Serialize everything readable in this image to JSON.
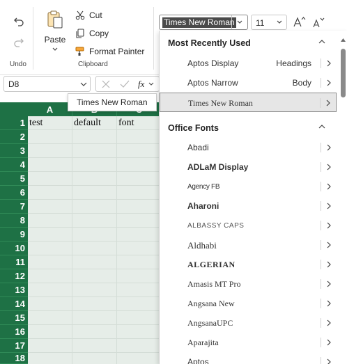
{
  "ribbon": {
    "undo_group_label": "Undo",
    "clipboard_group_label": "Clipboard",
    "paste_label": "Paste",
    "cut_label": "Cut",
    "copy_label": "Copy",
    "format_painter_label": "Format Painter",
    "font_name": "Times New Roman",
    "font_size": "11"
  },
  "formula_bar": {
    "name_box": "D8",
    "fx_label": "fx"
  },
  "tooltip": "Times New Roman",
  "sheet": {
    "columns": [
      "A",
      "B",
      "C"
    ],
    "rows": [
      "1",
      "2",
      "3",
      "4",
      "5",
      "6",
      "7",
      "8",
      "9",
      "10",
      "11",
      "12",
      "13",
      "14",
      "15",
      "16",
      "17",
      "18"
    ],
    "row1": [
      "test",
      "default",
      "font"
    ],
    "header_color": "#1e7145"
  },
  "font_dropdown": {
    "recent_header": "Most Recently Used",
    "recent": [
      {
        "name": "Aptos Display",
        "role": "Headings"
      },
      {
        "name": "Aptos Narrow",
        "role": "Body"
      },
      {
        "name": "Times New Roman",
        "role": ""
      }
    ],
    "office_header": "Office Fonts",
    "office": [
      "Abadi",
      "ADLaM Display",
      "Agency FB",
      "Aharoni",
      "ALGERIAN",
      "Aldhabi",
      "ALGERIAN",
      "Amasis MT Pro",
      "Angsana New",
      "AngsanaUPC",
      "Aparajita",
      "Aptos"
    ]
  }
}
